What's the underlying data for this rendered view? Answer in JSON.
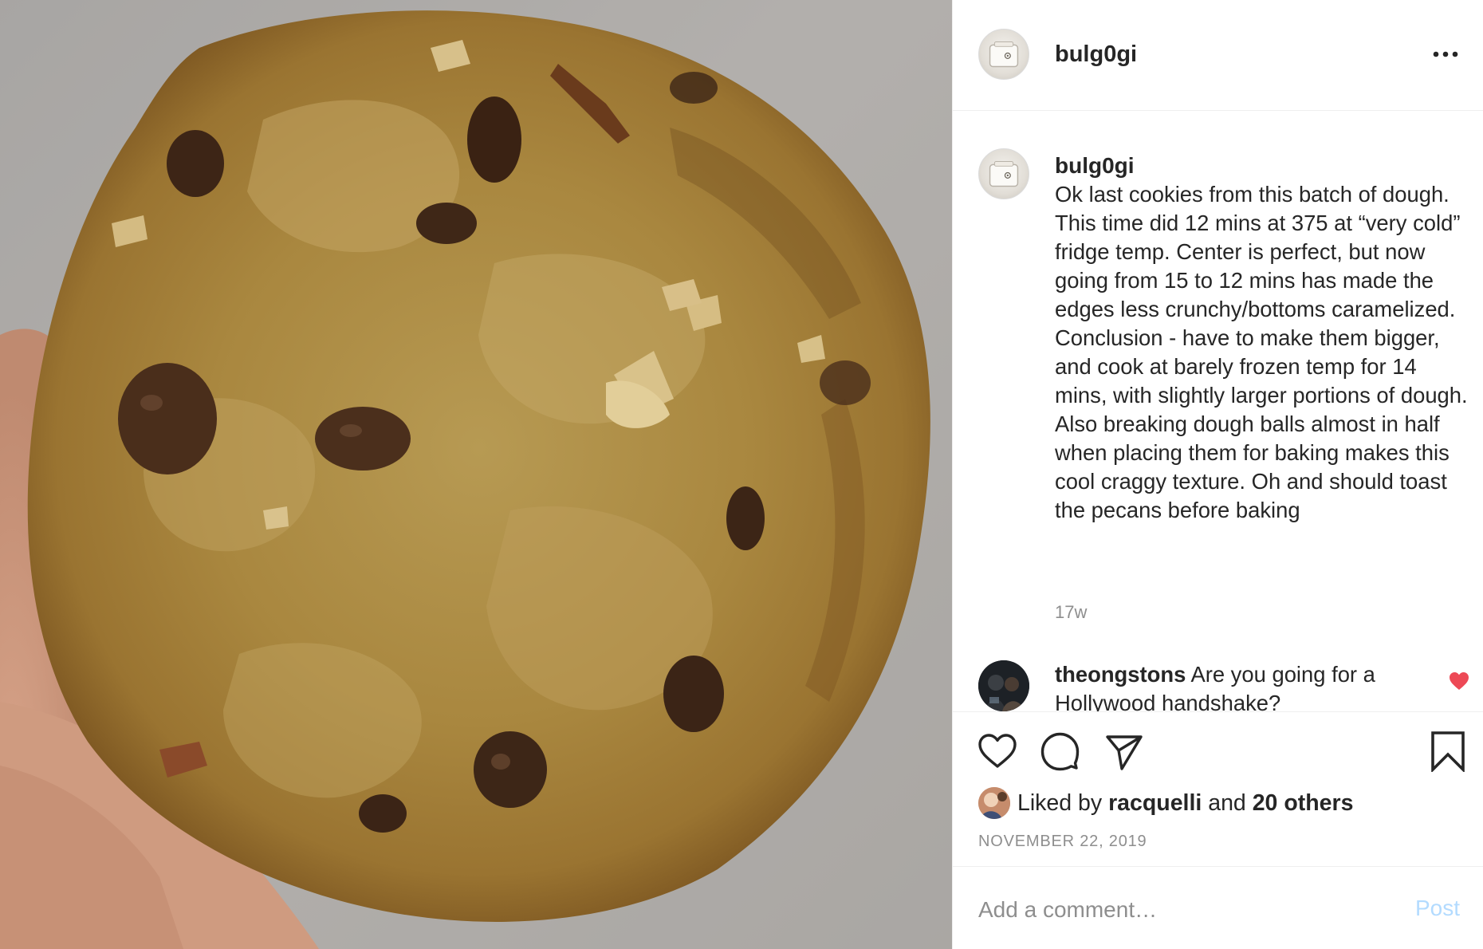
{
  "post": {
    "username": "bulg0gi",
    "caption": "Ok last cookies from this batch of dough. This time did 12 mins at 375 at “very cold” fridge temp. Center is perfect, but now going from 15 to 12 mins has made the edges less crunchy/bottoms caramelized. Conclusion - have to make them bigger, and cook at barely frozen temp for 14 mins, with slightly larger portions of dough. Also breaking dough balls almost in half when placing them for baking makes this cool craggy texture. Oh and should toast the pecans before baking",
    "time_ago": "17w",
    "date": "NOVEMBER 22, 2019"
  },
  "reply": {
    "username": "theongstons",
    "text": "Are you going for a Hollywood handshake?"
  },
  "likes": {
    "prefix": "Liked by",
    "user": "racquelli",
    "and": "and",
    "others": "20 others"
  },
  "comment_box": {
    "placeholder": "Add a comment…",
    "post_label": "Post"
  },
  "icons": {
    "more": "more-options-icon",
    "like": "heart-icon",
    "comment": "comment-bubble-icon",
    "share": "paper-plane-icon",
    "save": "bookmark-icon",
    "reply_like": "heart-filled-icon"
  },
  "colors": {
    "text": "#262626",
    "muted": "#8e8e8e",
    "post_button": "#b3dbff",
    "liked_heart": "#ed4956",
    "divider": "#efefef"
  }
}
